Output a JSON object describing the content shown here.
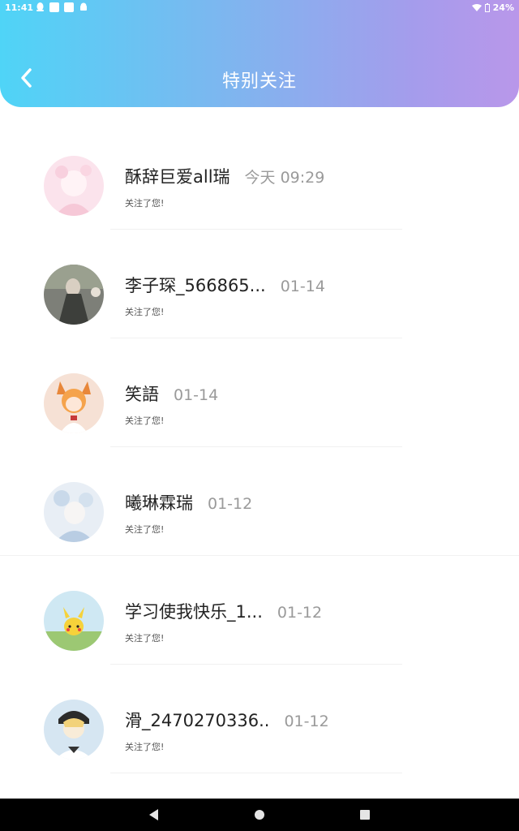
{
  "status_bar": {
    "time": "11:41",
    "battery": "24%"
  },
  "header": {
    "title": "特别关注",
    "back_icon": "chevron-left-icon"
  },
  "colors": {
    "gradient_start": "#4fd4f7",
    "gradient_end": "#b997ea",
    "name_text": "#222222",
    "date_text": "#9a9a9a"
  },
  "follows": [
    {
      "name": "酥辞巨爱all瑞",
      "date": "今天 09:29",
      "sub": "关注了您!"
    },
    {
      "name": "李子琛_566865...",
      "date": "01-14",
      "sub": "关注了您!"
    },
    {
      "name": "笑語",
      "date": "01-14",
      "sub": "关注了您!"
    },
    {
      "name": "曦琳霖瑞",
      "date": "01-12",
      "sub": "关注了您!"
    },
    {
      "name": "学习使我快乐_1...",
      "date": "01-12",
      "sub": "关注了您!"
    },
    {
      "name": "滑_2470270336..",
      "date": "01-12",
      "sub": "关注了您!"
    }
  ]
}
